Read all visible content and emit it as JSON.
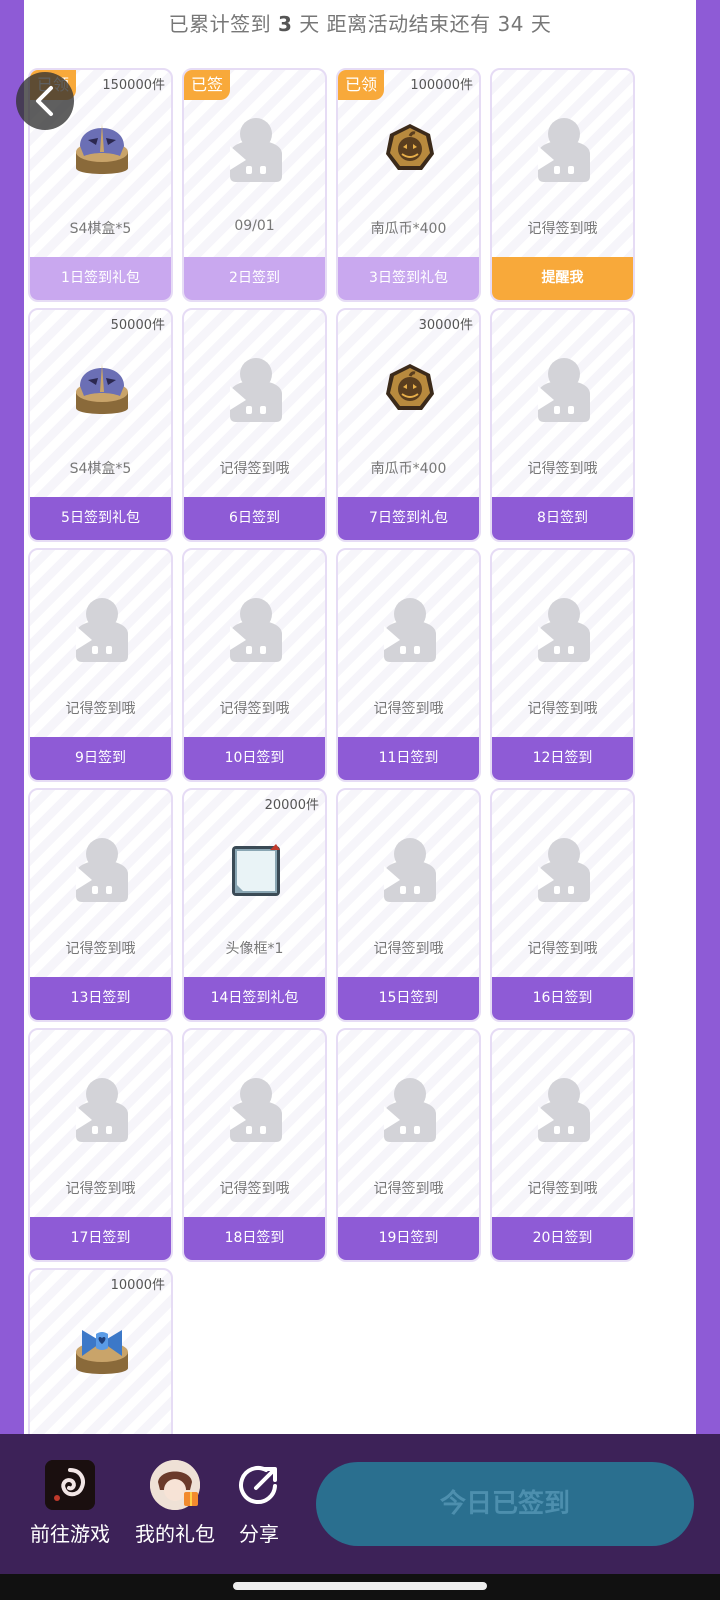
{
  "header": {
    "prefix": "已累计签到",
    "days_signed": "3",
    "mid": "天  距离活动结束还有",
    "days_left": "34",
    "suffix": "天"
  },
  "cards": [
    {
      "day_label": "1日签到礼包",
      "reward": "S4棋盒*5",
      "qty": "150000件",
      "badge": "已领",
      "status": "done",
      "icon": "mask-chest-icon"
    },
    {
      "day_label": "2日签到",
      "reward": "09/01",
      "qty": "",
      "badge": "已签",
      "status": "done",
      "icon": "placeholder-avatar-icon"
    },
    {
      "day_label": "3日签到礼包",
      "reward": "南瓜币*400",
      "qty": "100000件",
      "badge": "已领",
      "status": "done",
      "icon": "pumpkin-coin-icon"
    },
    {
      "day_label": "提醒我",
      "reward": "记得签到哦",
      "qty": "",
      "badge": "",
      "status": "remind",
      "icon": "placeholder-avatar-icon"
    },
    {
      "day_label": "5日签到礼包",
      "reward": "S4棋盒*5",
      "qty": "50000件",
      "badge": "",
      "status": "pending",
      "icon": "mask-chest-icon"
    },
    {
      "day_label": "6日签到",
      "reward": "记得签到哦",
      "qty": "",
      "badge": "",
      "status": "pending",
      "icon": "placeholder-avatar-icon"
    },
    {
      "day_label": "7日签到礼包",
      "reward": "南瓜币*400",
      "qty": "30000件",
      "badge": "",
      "status": "pending",
      "icon": "pumpkin-coin-icon"
    },
    {
      "day_label": "8日签到",
      "reward": "记得签到哦",
      "qty": "",
      "badge": "",
      "status": "pending",
      "icon": "placeholder-avatar-icon"
    },
    {
      "day_label": "9日签到",
      "reward": "记得签到哦",
      "qty": "",
      "badge": "",
      "status": "pending",
      "icon": "placeholder-avatar-icon"
    },
    {
      "day_label": "10日签到",
      "reward": "记得签到哦",
      "qty": "",
      "badge": "",
      "status": "pending",
      "icon": "placeholder-avatar-icon"
    },
    {
      "day_label": "11日签到",
      "reward": "记得签到哦",
      "qty": "",
      "badge": "",
      "status": "pending",
      "icon": "placeholder-avatar-icon"
    },
    {
      "day_label": "12日签到",
      "reward": "记得签到哦",
      "qty": "",
      "badge": "",
      "status": "pending",
      "icon": "placeholder-avatar-icon"
    },
    {
      "day_label": "13日签到",
      "reward": "记得签到哦",
      "qty": "",
      "badge": "",
      "status": "pending",
      "icon": "placeholder-avatar-icon"
    },
    {
      "day_label": "14日签到礼包",
      "reward": "头像框*1",
      "qty": "20000件",
      "badge": "",
      "status": "pending",
      "icon": "avatar-frame-icon"
    },
    {
      "day_label": "15日签到",
      "reward": "记得签到哦",
      "qty": "",
      "badge": "",
      "status": "pending",
      "icon": "placeholder-avatar-icon"
    },
    {
      "day_label": "16日签到",
      "reward": "记得签到哦",
      "qty": "",
      "badge": "",
      "status": "pending",
      "icon": "placeholder-avatar-icon"
    },
    {
      "day_label": "17日签到",
      "reward": "记得签到哦",
      "qty": "",
      "badge": "",
      "status": "pending",
      "icon": "placeholder-avatar-icon"
    },
    {
      "day_label": "18日签到",
      "reward": "记得签到哦",
      "qty": "",
      "badge": "",
      "status": "pending",
      "icon": "placeholder-avatar-icon"
    },
    {
      "day_label": "19日签到",
      "reward": "记得签到哦",
      "qty": "",
      "badge": "",
      "status": "pending",
      "icon": "placeholder-avatar-icon"
    },
    {
      "day_label": "20日签到",
      "reward": "记得签到哦",
      "qty": "",
      "badge": "",
      "status": "pending",
      "icon": "placeholder-avatar-icon"
    },
    {
      "day_label": "",
      "reward": "",
      "qty": "10000件",
      "badge": "",
      "status": "pending",
      "icon": "bow-chest-icon"
    }
  ],
  "bottom_nav": {
    "go_game": "前往游戏",
    "my_gifts": "我的礼包",
    "share": "分享",
    "sign_button": "今日已签到"
  }
}
